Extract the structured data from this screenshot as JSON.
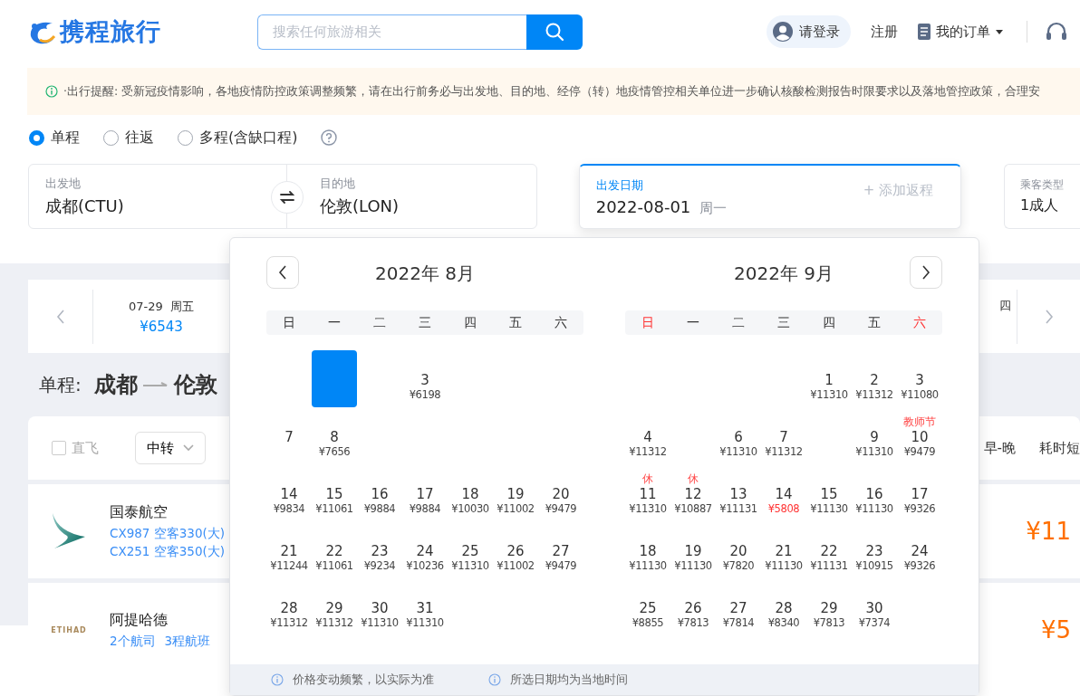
{
  "header": {
    "logo": "携程旅行",
    "search": {
      "placeholder": "搜索任何旅游相关"
    },
    "nav": [
      {
        "kind": "login",
        "label": "请登录"
      },
      {
        "kind": "link",
        "label": "注册"
      },
      {
        "kind": "orders",
        "label": "我的订单"
      }
    ]
  },
  "notice": "·出行提醒: 受新冠疫情影响，各地疫情防控政策调整频繁，请在出行前务必与出发地、目的地、经停（转）地疫情管控相关单位进一步确认核酸检测报告时限要求以及落地管控政策，合理安",
  "trip_types": [
    {
      "label": "单程",
      "selected": true
    },
    {
      "label": "往返",
      "selected": false
    },
    {
      "label": "多程(含缺口程)",
      "selected": false
    }
  ],
  "form": {
    "from": {
      "label": "出发地",
      "value": "成都(CTU)"
    },
    "to": {
      "label": "目的地",
      "value": "伦敦(LON)"
    },
    "date": {
      "label": "出发日期",
      "value": "2022-08-01",
      "weekday": "周一",
      "add_return": "+ 添加返程"
    },
    "passengers": {
      "label": "乘客类型",
      "value": "1成人"
    }
  },
  "date_strip": [
    {
      "kind": "full",
      "date": "07-29",
      "weekday": "周五",
      "price": "¥6543"
    },
    {
      "kind": "cut",
      "weekday": "四"
    }
  ],
  "route": {
    "prefix": "单程:",
    "from": "成都",
    "to": "伦敦"
  },
  "filters": {
    "direct": {
      "label": "直飞",
      "checked": false
    },
    "transfer": "中转",
    "sort": [
      "早-晚",
      "耗时短"
    ]
  },
  "flights": [
    {
      "kind": "wing",
      "airline": "国泰航空",
      "details": [
        "CX987 空客330(大)",
        "CX251 空客350(大)"
      ],
      "price": "¥11"
    },
    {
      "kind": "wordmark",
      "airline": "阿提哈德",
      "logo_text": "ETIHAD",
      "details": [
        "2个航司",
        "3程航班"
      ],
      "price": "¥5"
    }
  ],
  "calendar": {
    "months": [
      {
        "title": "2022年 8月",
        "weekdays": [
          {
            "label": "日",
            "weekend": false
          },
          {
            "label": "一",
            "weekend": false
          },
          {
            "label": "二",
            "weekend": false
          },
          {
            "label": "三",
            "weekend": false
          },
          {
            "label": "四",
            "weekend": false
          },
          {
            "label": "五",
            "weekend": false
          },
          {
            "label": "六",
            "weekend": false
          }
        ],
        "weeks": [
          [
            {
              "kind": "empty"
            },
            {
              "kind": "covered",
              "selected": true
            },
            {
              "kind": "covered"
            },
            {
              "kind": "day",
              "day": "3",
              "price": "¥6198",
              "selected": false,
              "low": false
            },
            {
              "kind": "covered"
            },
            {
              "kind": "covered"
            },
            {
              "kind": "covered"
            }
          ],
          [
            {
              "kind": "day",
              "day": "7",
              "selected": false
            },
            {
              "kind": "day",
              "day": "8",
              "price": "¥7656",
              "selected": false,
              "low": false
            },
            {
              "kind": "covered"
            },
            {
              "kind": "covered"
            },
            {
              "kind": "covered"
            },
            {
              "kind": "covered"
            },
            {
              "kind": "covered"
            }
          ],
          [
            {
              "kind": "day",
              "day": "14",
              "price": "¥9834",
              "selected": false,
              "low": false
            },
            {
              "kind": "day",
              "day": "15",
              "price": "¥11061",
              "selected": false,
              "low": false
            },
            {
              "kind": "day",
              "day": "16",
              "price": "¥9884",
              "selected": false,
              "low": false
            },
            {
              "kind": "day",
              "day": "17",
              "price": "¥9884",
              "selected": false,
              "low": false
            },
            {
              "kind": "day",
              "day": "18",
              "price": "¥10030",
              "selected": false,
              "low": false
            },
            {
              "kind": "day",
              "day": "19",
              "price": "¥11002",
              "selected": false,
              "low": false
            },
            {
              "kind": "day",
              "day": "20",
              "price": "¥9479",
              "selected": false,
              "low": false
            }
          ],
          [
            {
              "kind": "day",
              "day": "21",
              "price": "¥11244",
              "selected": false,
              "low": false
            },
            {
              "kind": "day",
              "day": "22",
              "price": "¥11061",
              "selected": false,
              "low": false
            },
            {
              "kind": "day",
              "day": "23",
              "price": "¥9234",
              "selected": false,
              "low": false
            },
            {
              "kind": "day",
              "day": "24",
              "price": "¥10236",
              "selected": false,
              "low": false
            },
            {
              "kind": "day",
              "day": "25",
              "price": "¥11310",
              "selected": false,
              "low": false
            },
            {
              "kind": "day",
              "day": "26",
              "price": "¥11002",
              "selected": false,
              "low": false
            },
            {
              "kind": "day",
              "day": "27",
              "price": "¥9479",
              "selected": false,
              "low": false
            }
          ],
          [
            {
              "kind": "day",
              "day": "28",
              "price": "¥11312",
              "selected": false,
              "low": false
            },
            {
              "kind": "day",
              "day": "29",
              "price": "¥11312",
              "selected": false,
              "low": false
            },
            {
              "kind": "day",
              "day": "30",
              "price": "¥11310",
              "selected": false,
              "low": false
            },
            {
              "kind": "day",
              "day": "31",
              "price": "¥11310",
              "selected": false,
              "low": false
            }
          ]
        ]
      },
      {
        "title": "2022年 9月",
        "weekdays": [
          {
            "label": "日",
            "weekend": true
          },
          {
            "label": "一",
            "weekend": false
          },
          {
            "label": "二",
            "weekend": false
          },
          {
            "label": "三",
            "weekend": false
          },
          {
            "label": "四",
            "weekend": false
          },
          {
            "label": "五",
            "weekend": false
          },
          {
            "label": "六",
            "weekend": true
          }
        ],
        "weeks": [
          [
            {
              "kind": "empty"
            },
            {
              "kind": "empty"
            },
            {
              "kind": "empty"
            },
            {
              "kind": "empty"
            },
            {
              "kind": "day",
              "day": "1",
              "price": "¥11310",
              "selected": false,
              "low": false
            },
            {
              "kind": "day",
              "day": "2",
              "price": "¥11312",
              "selected": false,
              "low": false
            },
            {
              "kind": "day",
              "day": "3",
              "price": "¥11080",
              "selected": false,
              "low": false
            }
          ],
          [
            {
              "kind": "day",
              "day": "4",
              "price": "¥11312",
              "selected": false,
              "low": false
            },
            {
              "kind": "covered"
            },
            {
              "kind": "day",
              "day": "6",
              "price": "¥11310",
              "selected": false,
              "low": false
            },
            {
              "kind": "day",
              "day": "7",
              "price": "¥11312",
              "selected": false,
              "low": false
            },
            {
              "kind": "covered"
            },
            {
              "kind": "day",
              "day": "9",
              "price": "¥11310",
              "selected": false,
              "low": false
            },
            {
              "kind": "day",
              "day": "10",
              "price": "¥9479",
              "tag": "教师节",
              "selected": false,
              "low": false
            }
          ],
          [
            {
              "kind": "day",
              "day": "11",
              "price": "¥11310",
              "tag": "休",
              "selected": false,
              "low": false
            },
            {
              "kind": "day",
              "day": "12",
              "price": "¥10887",
              "tag": "休",
              "selected": false,
              "low": false
            },
            {
              "kind": "day",
              "day": "13",
              "price": "¥11131",
              "selected": false,
              "low": false
            },
            {
              "kind": "day",
              "day": "14",
              "price": "¥5808",
              "selected": false,
              "low": true
            },
            {
              "kind": "day",
              "day": "15",
              "price": "¥11130",
              "selected": false,
              "low": false
            },
            {
              "kind": "day",
              "day": "16",
              "price": "¥11130",
              "selected": false,
              "low": false
            },
            {
              "kind": "day",
              "day": "17",
              "price": "¥9326",
              "selected": false,
              "low": false
            }
          ],
          [
            {
              "kind": "day",
              "day": "18",
              "price": "¥11130",
              "selected": false,
              "low": false
            },
            {
              "kind": "day",
              "day": "19",
              "price": "¥11130",
              "selected": false,
              "low": false
            },
            {
              "kind": "day",
              "day": "20",
              "price": "¥7820",
              "selected": false,
              "low": false
            },
            {
              "kind": "day",
              "day": "21",
              "price": "¥11130",
              "selected": false,
              "low": false
            },
            {
              "kind": "day",
              "day": "22",
              "price": "¥11131",
              "selected": false,
              "low": false
            },
            {
              "kind": "day",
              "day": "23",
              "price": "¥10915",
              "selected": false,
              "low": false
            },
            {
              "kind": "day",
              "day": "24",
              "price": "¥9326",
              "selected": false,
              "low": false
            }
          ],
          [
            {
              "kind": "day",
              "day": "25",
              "price": "¥8855",
              "selected": false,
              "low": false
            },
            {
              "kind": "day",
              "day": "26",
              "price": "¥7813",
              "selected": false,
              "low": false
            },
            {
              "kind": "day",
              "day": "27",
              "price": "¥7814",
              "selected": false,
              "low": false
            },
            {
              "kind": "day",
              "day": "28",
              "price": "¥8340",
              "selected": false,
              "low": false
            },
            {
              "kind": "day",
              "day": "29",
              "price": "¥7813",
              "selected": false,
              "low": false
            },
            {
              "kind": "day",
              "day": "30",
              "price": "¥7374",
              "selected": false,
              "low": false
            }
          ]
        ]
      }
    ],
    "notes": [
      "价格变动频繁，以实际为准",
      "所选日期均为当地时间"
    ]
  }
}
